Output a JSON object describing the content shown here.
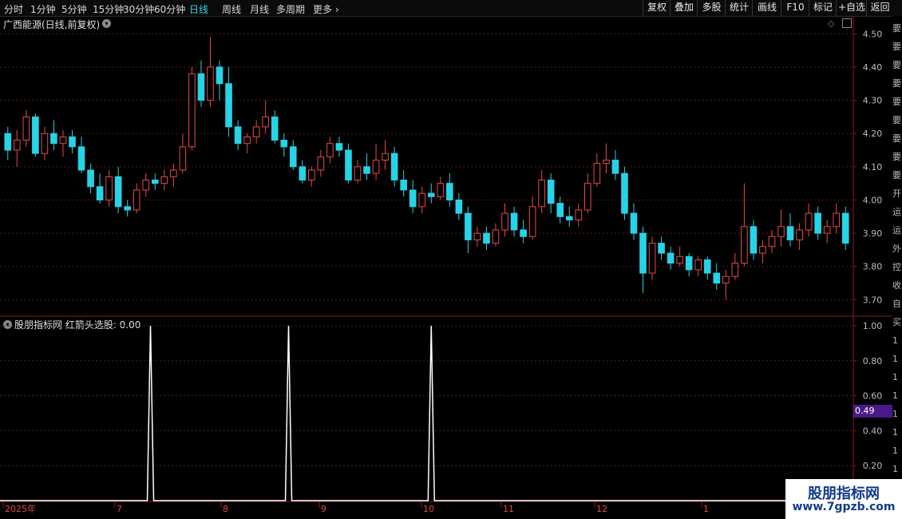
{
  "toolbar": {
    "period_tabs": [
      "分时",
      "1分钟",
      "5分钟",
      "15分钟",
      "30分钟",
      "60分钟",
      "日线",
      "周线",
      "月线",
      "多周期",
      "更多"
    ],
    "active_tab": "日线",
    "right_buttons": [
      "复权",
      "叠加",
      "多股",
      "统计",
      "画线",
      "F10",
      "标记",
      "+自选",
      "返回"
    ]
  },
  "main_panel": {
    "title": "广西能源(日线,前复权)",
    "price_axis": [
      "4.50",
      "4.40",
      "4.30",
      "4.20",
      "4.10",
      "4.00",
      "3.90",
      "3.80",
      "3.70"
    ]
  },
  "indicator_panel": {
    "title": "股朋指标网  红箭头选股: 0.00",
    "axis": [
      "1.00",
      "0.80",
      "0.60",
      "0.40",
      "0.20"
    ],
    "current_value": "0.49"
  },
  "time_axis": [
    "2025年",
    "7",
    "8",
    "9",
    "10",
    "11",
    "12",
    "1"
  ],
  "right_edge_glyphs": [
    "要",
    "要",
    "要",
    "要",
    "要",
    "要",
    "要",
    "要",
    "要",
    "开",
    "运",
    "运",
    "外",
    "控",
    "收",
    "自",
    "买",
    "1",
    "1",
    "1",
    "1",
    "1",
    "1",
    "1",
    "1"
  ],
  "watermark": {
    "name": "股朋指标网",
    "url": "www.7gpzb.com"
  },
  "colors": {
    "up": "#e84a4a",
    "down": "#27d3e6",
    "grid": "#5a1a1a",
    "border": "#8a1a1a",
    "signal": "#ffffff",
    "highlight": "#4a1a8a"
  },
  "chart_data": [
    {
      "type": "candlestick",
      "title": "广西能源(日线,前复权)",
      "ylim": [
        3.66,
        4.52
      ],
      "ohlc": [
        [
          4.2,
          4.22,
          4.12,
          4.15
        ],
        [
          4.15,
          4.21,
          4.1,
          4.18
        ],
        [
          4.18,
          4.27,
          4.16,
          4.25
        ],
        [
          4.25,
          4.26,
          4.13,
          4.14
        ],
        [
          4.14,
          4.22,
          4.12,
          4.2
        ],
        [
          4.2,
          4.24,
          4.15,
          4.17
        ],
        [
          4.17,
          4.21,
          4.13,
          4.19
        ],
        [
          4.19,
          4.21,
          4.14,
          4.16
        ],
        [
          4.16,
          4.19,
          4.08,
          4.09
        ],
        [
          4.09,
          4.11,
          4.02,
          4.04
        ],
        [
          4.04,
          4.08,
          3.99,
          4.0
        ],
        [
          4.0,
          4.09,
          3.98,
          4.07
        ],
        [
          4.07,
          4.1,
          3.96,
          3.98
        ],
        [
          3.98,
          4.0,
          3.95,
          3.97
        ],
        [
          3.97,
          4.05,
          3.96,
          4.03
        ],
        [
          4.03,
          4.08,
          4.01,
          4.06
        ],
        [
          4.06,
          4.08,
          4.03,
          4.05
        ],
        [
          4.05,
          4.09,
          4.03,
          4.07
        ],
        [
          4.07,
          4.11,
          4.04,
          4.09
        ],
        [
          4.09,
          4.2,
          4.08,
          4.16
        ],
        [
          4.16,
          4.4,
          4.15,
          4.38
        ],
        [
          4.38,
          4.42,
          4.28,
          4.3
        ],
        [
          4.3,
          4.49,
          4.28,
          4.4
        ],
        [
          4.4,
          4.42,
          4.3,
          4.35
        ],
        [
          4.35,
          4.4,
          4.19,
          4.22
        ],
        [
          4.22,
          4.24,
          4.15,
          4.17
        ],
        [
          4.17,
          4.2,
          4.14,
          4.19
        ],
        [
          4.19,
          4.24,
          4.17,
          4.22
        ],
        [
          4.22,
          4.3,
          4.2,
          4.25
        ],
        [
          4.25,
          4.27,
          4.17,
          4.18
        ],
        [
          4.18,
          4.2,
          4.13,
          4.16
        ],
        [
          4.16,
          4.18,
          4.09,
          4.1
        ],
        [
          4.1,
          4.12,
          4.05,
          4.06
        ],
        [
          4.06,
          4.1,
          4.04,
          4.09
        ],
        [
          4.09,
          4.15,
          4.07,
          4.13
        ],
        [
          4.13,
          4.19,
          4.11,
          4.17
        ],
        [
          4.17,
          4.19,
          4.13,
          4.15
        ],
        [
          4.15,
          4.17,
          4.05,
          4.06
        ],
        [
          4.06,
          4.12,
          4.05,
          4.1
        ],
        [
          4.1,
          4.14,
          4.06,
          4.08
        ],
        [
          4.08,
          4.17,
          4.06,
          4.12
        ],
        [
          4.12,
          4.18,
          4.09,
          4.14
        ],
        [
          4.14,
          4.16,
          4.04,
          4.06
        ],
        [
          4.06,
          4.09,
          4.01,
          4.03
        ],
        [
          4.03,
          4.06,
          3.96,
          3.98
        ],
        [
          3.98,
          4.04,
          3.96,
          4.02
        ],
        [
          4.02,
          4.05,
          3.99,
          4.01
        ],
        [
          4.01,
          4.07,
          4.0,
          4.05
        ],
        [
          4.05,
          4.08,
          3.98,
          4.0
        ],
        [
          4.0,
          4.02,
          3.94,
          3.96
        ],
        [
          3.96,
          3.98,
          3.84,
          3.88
        ],
        [
          3.88,
          3.92,
          3.86,
          3.9
        ],
        [
          3.9,
          3.92,
          3.85,
          3.87
        ],
        [
          3.87,
          3.93,
          3.86,
          3.91
        ],
        [
          3.91,
          3.99,
          3.89,
          3.96
        ],
        [
          3.96,
          3.98,
          3.89,
          3.91
        ],
        [
          3.91,
          3.94,
          3.87,
          3.89
        ],
        [
          3.89,
          4.01,
          3.88,
          3.98
        ],
        [
          3.98,
          4.09,
          3.96,
          4.06
        ],
        [
          4.06,
          4.08,
          3.96,
          3.99
        ],
        [
          3.99,
          4.01,
          3.93,
          3.95
        ],
        [
          3.95,
          3.98,
          3.92,
          3.94
        ],
        [
          3.94,
          3.99,
          3.92,
          3.97
        ],
        [
          3.97,
          4.08,
          3.96,
          4.05
        ],
        [
          4.05,
          4.14,
          4.04,
          4.11
        ],
        [
          4.11,
          4.17,
          4.08,
          4.12
        ],
        [
          4.12,
          4.15,
          4.06,
          4.08
        ],
        [
          4.08,
          4.1,
          3.94,
          3.96
        ],
        [
          3.96,
          3.99,
          3.88,
          3.9
        ],
        [
          3.9,
          3.92,
          3.72,
          3.78
        ],
        [
          3.78,
          3.89,
          3.76,
          3.87
        ],
        [
          3.87,
          3.89,
          3.82,
          3.84
        ],
        [
          3.84,
          3.86,
          3.79,
          3.81
        ],
        [
          3.81,
          3.86,
          3.8,
          3.83
        ],
        [
          3.83,
          3.84,
          3.77,
          3.79
        ],
        [
          3.79,
          3.83,
          3.77,
          3.82
        ],
        [
          3.82,
          3.83,
          3.76,
          3.78
        ],
        [
          3.78,
          3.81,
          3.73,
          3.75
        ],
        [
          3.75,
          3.79,
          3.7,
          3.77
        ],
        [
          3.77,
          3.84,
          3.76,
          3.81
        ],
        [
          3.81,
          4.05,
          3.8,
          3.92
        ],
        [
          3.92,
          3.94,
          3.82,
          3.84
        ],
        [
          3.84,
          3.88,
          3.81,
          3.86
        ],
        [
          3.86,
          3.91,
          3.84,
          3.89
        ],
        [
          3.89,
          3.97,
          3.86,
          3.92
        ],
        [
          3.92,
          3.96,
          3.86,
          3.88
        ],
        [
          3.88,
          3.93,
          3.85,
          3.91
        ],
        [
          3.91,
          3.99,
          3.89,
          3.96
        ],
        [
          3.96,
          3.98,
          3.88,
          3.9
        ],
        [
          3.9,
          3.94,
          3.87,
          3.92
        ],
        [
          3.92,
          3.99,
          3.9,
          3.96
        ],
        [
          3.96,
          3.98,
          3.85,
          3.87
        ]
      ]
    },
    {
      "type": "line",
      "title": "红箭头选股",
      "ylim": [
        0,
        1.05
      ],
      "x": [
        0,
        15.5,
        30.5,
        46,
        92
      ],
      "values": [
        0,
        1,
        1,
        1,
        0
      ],
      "signal_indices": [
        15.5,
        30.5,
        46
      ]
    }
  ]
}
